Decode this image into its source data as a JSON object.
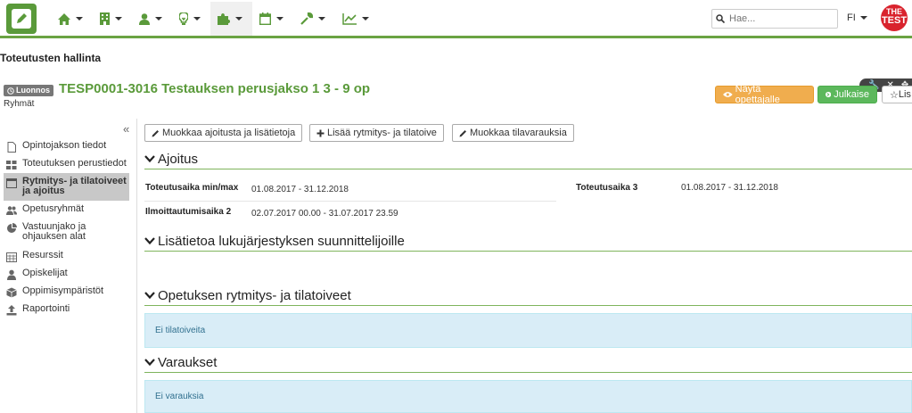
{
  "topbar": {
    "nav_icons": [
      "home-icon",
      "building-icon",
      "user-icon",
      "lightbulb-icon",
      "puzzle-icon",
      "calendar-icon",
      "wrench-icon",
      "chart-icon"
    ],
    "search_placeholder": "Hae...",
    "language": "FI",
    "brand_top": "THE",
    "brand_main": "TEST"
  },
  "header": {
    "page_title": "Toteutusten hallinta",
    "status_badge": "Luonnos",
    "course_title": "TESP0001-3016 Testauksen perusjakso 1 3 - 9 op",
    "groups_label": "Ryhmät",
    "show_teacher_button": "Näytä opettajalle",
    "publish_button": "Julkaise",
    "more_button": "Lis"
  },
  "sidebar": {
    "collapse_label": "«",
    "items": [
      {
        "label": "Opintojakson tiedot",
        "icon": "file-icon"
      },
      {
        "label": "Toteutuksen perustiedot",
        "icon": "grid-icon"
      },
      {
        "label": "Rytmitys- ja tilatoiveet ja ajoitus",
        "icon": "calendar-icon"
      },
      {
        "label": "Opetusryhmät",
        "icon": "users-icon"
      },
      {
        "label": "Vastuunjako ja ohjauksen alat",
        "icon": "pie-chart-icon"
      },
      {
        "label": "Resurssit",
        "icon": "calendar-grid-icon"
      },
      {
        "label": "Opiskelijat",
        "icon": "user-icon"
      },
      {
        "label": "Oppimisympäristöt",
        "icon": "cube-icon"
      },
      {
        "label": "Raportointi",
        "icon": "upload-icon"
      }
    ]
  },
  "actions": {
    "edit_schedule": "Muokkaa ajoitusta ja lisätietoja",
    "add_rhythm": "Lisää rytmitys- ja tilatoive",
    "edit_reservations": "Muokkaa tilavarauksia"
  },
  "sections": {
    "ajoitus": {
      "title": "Ajoitus",
      "fields": [
        {
          "label": "Toteutusaika min/max",
          "value": "01.08.2017 - 31.12.2018"
        },
        {
          "label": "Ilmoittautumisaika 2",
          "value": "02.07.2017 00.00 - 31.07.2017 23.59"
        },
        {
          "label": "Toteutusaika 3",
          "value": "01.08.2017 - 31.12.2018"
        }
      ]
    },
    "lisatietoa": {
      "title": "Lisätietoa lukujärjestyksen suunnittelijoille"
    },
    "rytmitys": {
      "title": "Opetuksen rytmitys- ja tilatoiveet",
      "empty": "Ei tilatoiveita"
    },
    "varaukset": {
      "title": "Varaukset",
      "empty": "Ei varauksia"
    }
  },
  "colors": {
    "accent": "#5a9a3a",
    "warning": "#f0ad4e",
    "success": "#5cb85c",
    "info_bg": "#d9edf7"
  }
}
